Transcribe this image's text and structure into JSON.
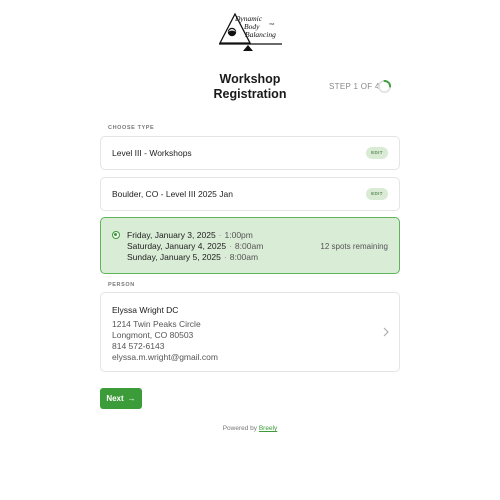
{
  "logo": {
    "line1": "Dynamic",
    "line2": "Body",
    "line3": "Balancing",
    "tm": "TM"
  },
  "header": {
    "title_line1": "Workshop",
    "title_line2": "Registration",
    "step": "STEP 1 OF 4",
    "step_progress": 0.25
  },
  "choose_type": {
    "label": "CHOOSE TYPE",
    "items": [
      {
        "text": "Level III - Workshops",
        "edit": "EDIT"
      },
      {
        "text": "Boulder, CO - Level III 2025 Jan",
        "edit": "EDIT"
      }
    ]
  },
  "schedule": {
    "dates": [
      {
        "date": "Friday, January 3, 2025",
        "time": "1:00pm"
      },
      {
        "date": "Saturday, January 4, 2025",
        "time": "8:00am"
      },
      {
        "date": "Sunday, January 5, 2025",
        "time": "8:00am"
      }
    ],
    "spots": "12 spots remaining",
    "separator": "·"
  },
  "person": {
    "label": "PERSON",
    "name": "Elyssa Wright DC",
    "address1": "1214 Twin Peaks Circle",
    "address2": "Longmont, CO 80503",
    "phone": "814 572-6143",
    "email": "elyssa.m.wright@gmail.com"
  },
  "actions": {
    "next": "Next",
    "arrow": "→"
  },
  "footer": {
    "powered_by": "Powered by",
    "brand": "Breely"
  },
  "colors": {
    "accent": "#3c9c3a",
    "selected_bg": "#d9ecd6",
    "badge_bg": "#d9ead5"
  }
}
